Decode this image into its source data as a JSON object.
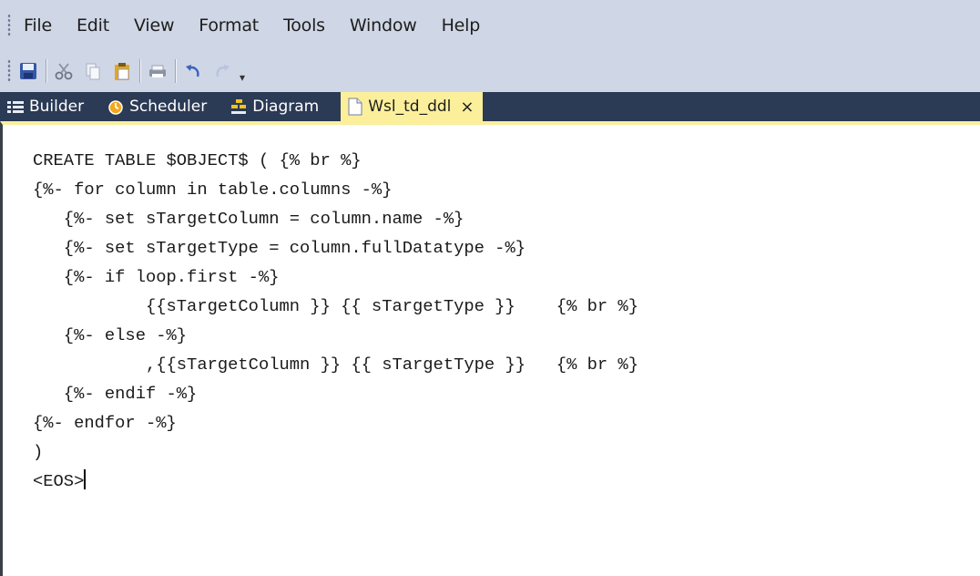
{
  "menu": [
    "File",
    "Edit",
    "View",
    "Format",
    "Tools",
    "Window",
    "Help"
  ],
  "toolbar": {
    "icons": [
      "save-icon",
      "cut-icon",
      "copy-icon",
      "paste-icon",
      "print-icon",
      "undo-icon",
      "redo-icon"
    ]
  },
  "tabs": {
    "builder": "Builder",
    "scheduler": "Scheduler",
    "diagram": "Diagram",
    "active": "Wsl_td_ddl",
    "close": "×"
  },
  "editor": {
    "lines": [
      "CREATE TABLE $OBJECT$ ( {% br %}",
      "{%- for column in table.columns -%}",
      "   {%- set sTargetColumn = column.name -%}",
      "   {%- set sTargetType = column.fullDatatype -%}",
      "   {%- if loop.first -%}",
      "           {{sTargetColumn }} {{ sTargetType }}    {% br %}",
      "   {%- else -%}",
      "           ,{{sTargetColumn }} {{ sTargetType }}   {% br %}",
      "   {%- endif -%}",
      "{%- endfor -%}",
      ")",
      "<EOS>"
    ]
  },
  "colors": {
    "chrome": "#cfd6e5",
    "tab_strip": "#2b3a55",
    "active_tab": "#fbef9b",
    "editor_bg": "#ffffff"
  }
}
